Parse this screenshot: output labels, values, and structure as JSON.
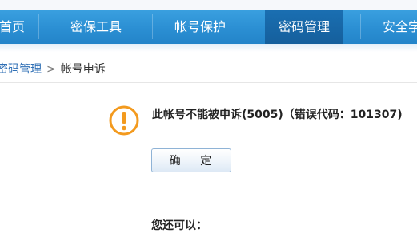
{
  "nav": {
    "items": [
      {
        "label": "首页",
        "active": false
      },
      {
        "label": "密保工具",
        "active": false
      },
      {
        "label": "帐号保护",
        "active": false
      },
      {
        "label": "密码管理",
        "active": true
      },
      {
        "label": "安全学"
      }
    ]
  },
  "breadcrumb": {
    "parent": "密码管理",
    "separator": ">",
    "current": "帐号申诉"
  },
  "message": {
    "text": "此帐号不能被申诉(5005)（错误代码：101307)",
    "icon": "warning-icon",
    "icon_color": "#f39a1e"
  },
  "confirm_button": "确 定",
  "also_label": "您还可以："
}
